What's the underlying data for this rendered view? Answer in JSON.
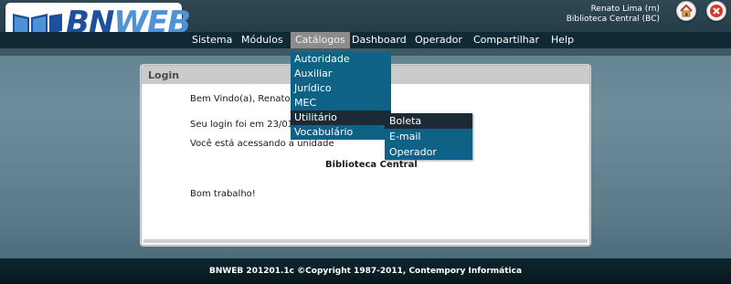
{
  "header": {
    "logo_text_main": "BN",
    "logo_text_accent": "WEB",
    "user_name": "Renato Lima (rn)",
    "library": "Biblioteca Central (BC)"
  },
  "nav": {
    "items": [
      "Sistema",
      "Módulos",
      "Catálogos",
      "Dashboard",
      "Operador",
      "Compartilhar",
      "Help"
    ],
    "active": "Catálogos"
  },
  "catalogos_menu": {
    "items": [
      "Autoridade",
      "Auxiliar",
      "Jurídico",
      "MEC",
      "Utilitário",
      "Vocabulário"
    ],
    "active": "Utilitário"
  },
  "utilitario_submenu": {
    "items": [
      "Boleta",
      "E-mail",
      "Operador"
    ],
    "active": "Boleta"
  },
  "login_panel": {
    "title": "Login",
    "welcome": "Bem Vindo(a), Renato Li",
    "last_login": "Seu login foi em 23/01/",
    "access": "Você está acessando a unidade",
    "unit": "Biblioteca Central",
    "closing": "Bom trabalho!"
  },
  "footer": {
    "text": "BNWEB 201201.1c ©Copyright 1987-2011, Contempory Informática"
  },
  "colors": {
    "nav_bg": "#0f2a35",
    "menu_bg": "#0e6285",
    "menu_active": "#1b2a33",
    "logo_blue": "#1e4f9c"
  }
}
